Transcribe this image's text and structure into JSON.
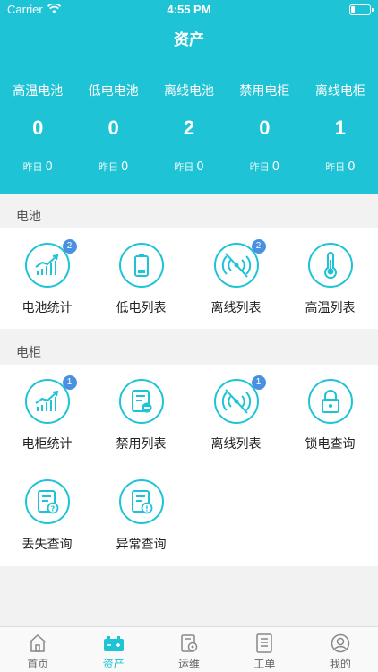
{
  "status_bar": {
    "carrier": "Carrier",
    "time": "4:55 PM"
  },
  "title": "资产",
  "stats": [
    {
      "label": "高温电池",
      "value": "0",
      "yesterday_label": "昨日",
      "yesterday_value": "0"
    },
    {
      "label": "低电电池",
      "value": "0",
      "yesterday_label": "昨日",
      "yesterday_value": "0"
    },
    {
      "label": "离线电池",
      "value": "2",
      "yesterday_label": "昨日",
      "yesterday_value": "0"
    },
    {
      "label": "禁用电柜",
      "value": "0",
      "yesterday_label": "昨日",
      "yesterday_value": "0"
    },
    {
      "label": "离线电柜",
      "value": "1",
      "yesterday_label": "昨日",
      "yesterday_value": "0"
    }
  ],
  "battery_section": {
    "title": "电池",
    "items": [
      {
        "label": "电池统计",
        "icon": "statistics-chart-icon",
        "badge": "2"
      },
      {
        "label": "低电列表",
        "icon": "low-battery-icon",
        "badge": ""
      },
      {
        "label": "离线列表",
        "icon": "offline-signal-icon",
        "badge": "2"
      },
      {
        "label": "高温列表",
        "icon": "thermometer-icon",
        "badge": ""
      }
    ]
  },
  "cabinet_section": {
    "title": "电柜",
    "items": [
      {
        "label": "电柜统计",
        "icon": "statistics-chart-icon",
        "badge": "1"
      },
      {
        "label": "禁用列表",
        "icon": "disabled-list-icon",
        "badge": ""
      },
      {
        "label": "离线列表",
        "icon": "offline-signal-icon",
        "badge": "1"
      },
      {
        "label": "锁电查询",
        "icon": "lock-icon",
        "badge": ""
      },
      {
        "label": "丢失查询",
        "icon": "lost-query-icon",
        "badge": ""
      },
      {
        "label": "异常查询",
        "icon": "exception-query-icon",
        "badge": ""
      }
    ]
  },
  "tabbar": [
    {
      "label": "首页",
      "icon": "home-icon",
      "active": false
    },
    {
      "label": "资产",
      "icon": "assets-battery-icon",
      "active": true
    },
    {
      "label": "运维",
      "icon": "maintenance-gear-icon",
      "active": false
    },
    {
      "label": "工单",
      "icon": "work-order-icon",
      "active": false
    },
    {
      "label": "我的",
      "icon": "profile-icon",
      "active": false
    }
  ],
  "colors": {
    "accent": "#1ec3d6",
    "badge": "#4a90e2",
    "background": "#f2f2f2"
  }
}
